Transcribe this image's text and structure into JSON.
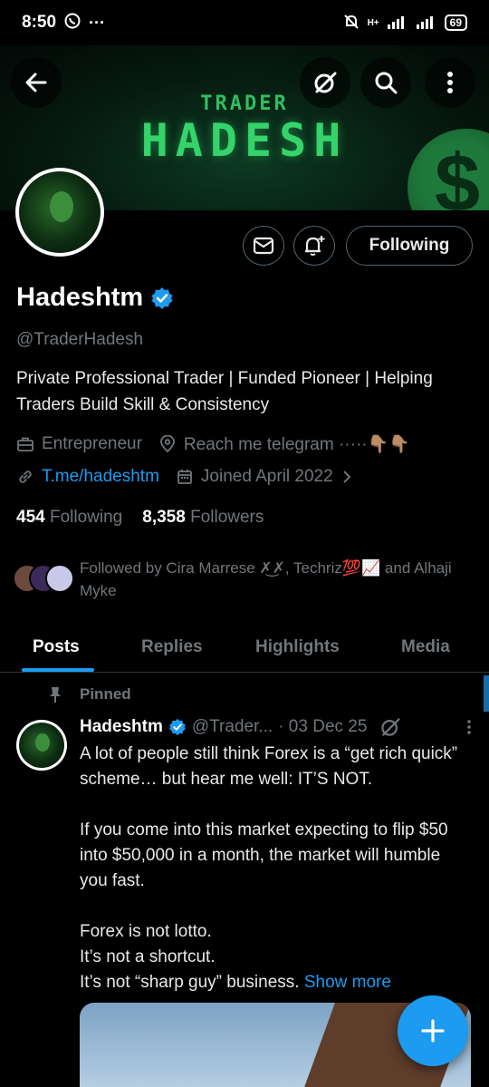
{
  "status_bar": {
    "time": "8:50",
    "network": "H+",
    "battery": "69"
  },
  "banner": {
    "line1": "TRADER",
    "line2": "HADESH"
  },
  "profile": {
    "name": "Hadeshtm",
    "handle": "@TraderHadesh",
    "bio": "Private Professional Trader | Funded Pioneer | Helping Traders Build Skill & Consistency",
    "category": "Entrepreneur",
    "location": "Reach me telegram ·····👇🏽👇🏽",
    "website": "T.me/hadeshtm",
    "joined": "Joined April 2022",
    "following_count": "454",
    "following_label": "Following",
    "followers_count": "8,358",
    "followers_label": "Followers",
    "followed_by": "Followed by Cira Marrese ✗͜✗, Techriz💯📈 and Alhaji Myke",
    "follow_button": "Following"
  },
  "tabs": [
    "Posts",
    "Replies",
    "Highlights",
    "Media"
  ],
  "post": {
    "pinned_label": "Pinned",
    "author": "Hadeshtm",
    "handle": "@Trader...",
    "date": "· 03 Dec 25",
    "body": "A lot of people still think Forex is a “get rich quick” scheme… but hear me well: IT’S NOT.\n\nIf you come into this market expecting to flip $50 into $50,000 in a month, the market will humble you fast.\n\nForex is not lotto.\nIt’s not a shortcut.\nIt’s not “sharp guy” business. ",
    "show_more": "Show more"
  },
  "icons": {
    "back": "arrow-left-icon",
    "grok": "grok-icon",
    "search": "search-icon",
    "more": "more-vertical-icon",
    "message": "mail-icon",
    "notify": "bell-plus-icon",
    "verified": "verified-badge-icon",
    "compose": "plus-icon"
  },
  "colors": {
    "accent": "#1d9bf0",
    "background": "#000000",
    "muted": "#71767b",
    "banner_green": "#35d46b"
  }
}
